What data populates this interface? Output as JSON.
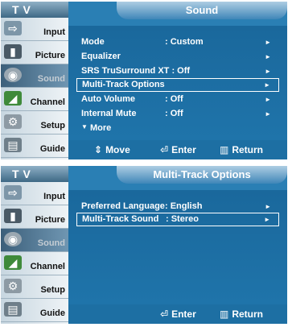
{
  "screens": [
    {
      "logo": "TV",
      "title": "Sound",
      "sidebar": [
        {
          "icon": "input-icon",
          "label": "Input",
          "active": false,
          "dim": false
        },
        {
          "icon": "picture-icon",
          "label": "Picture",
          "active": false,
          "dim": false
        },
        {
          "icon": "sound-icon",
          "label": "Sound",
          "active": true,
          "dim": true
        },
        {
          "icon": "channel-icon",
          "label": "Channel",
          "active": false,
          "dim": false
        },
        {
          "icon": "setup-icon",
          "label": "Setup",
          "active": false,
          "dim": false
        },
        {
          "icon": "guide-icon",
          "label": "Guide",
          "active": false,
          "dim": false
        }
      ],
      "menu": [
        {
          "label": "Mode",
          "value": ": Custom",
          "arrow": "►",
          "selected": false
        },
        {
          "label": "Equalizer",
          "value": "",
          "arrow": "►",
          "selected": false
        },
        {
          "label": "SRS TruSurround XT : Off",
          "value": "",
          "arrow": "►",
          "selected": false
        },
        {
          "label": "Multi-Track Options",
          "value": "",
          "arrow": "►",
          "selected": true
        },
        {
          "label": "Auto Volume",
          "value": ": Off",
          "arrow": "►",
          "selected": false
        },
        {
          "label": "Internal Mute",
          "value": ": Off",
          "arrow": "►",
          "selected": false
        }
      ],
      "more": "More",
      "footer": {
        "move": "Move",
        "enter": "Enter",
        "return": "Return"
      }
    },
    {
      "logo": "TV",
      "title": "Multi-Track Options",
      "sidebar": [
        {
          "icon": "input-icon",
          "label": "Input",
          "active": false,
          "dim": false
        },
        {
          "icon": "picture-icon",
          "label": "Picture",
          "active": false,
          "dim": false
        },
        {
          "icon": "sound-icon",
          "label": "Sound",
          "active": true,
          "dim": true
        },
        {
          "icon": "channel-icon",
          "label": "Channel",
          "active": false,
          "dim": false
        },
        {
          "icon": "setup-icon",
          "label": "Setup",
          "active": false,
          "dim": false
        },
        {
          "icon": "guide-icon",
          "label": "Guide",
          "active": false,
          "dim": false
        }
      ],
      "menu": [
        {
          "label": "Preferred Language",
          "value": ": English",
          "arrow": "►",
          "selected": false
        },
        {
          "label": "Multi-Track Sound",
          "value": ": Stereo",
          "arrow": "►",
          "selected": true
        }
      ],
      "footer": {
        "enter": "Enter",
        "return": "Return"
      }
    }
  ],
  "colors": {
    "panel": "#1d6fa3",
    "highlight_border": "#ffffff"
  },
  "icons": {
    "move": "up-down-arrow-icon",
    "enter": "enter-icon",
    "return": "return-icon",
    "more": "down-triangle-icon"
  }
}
